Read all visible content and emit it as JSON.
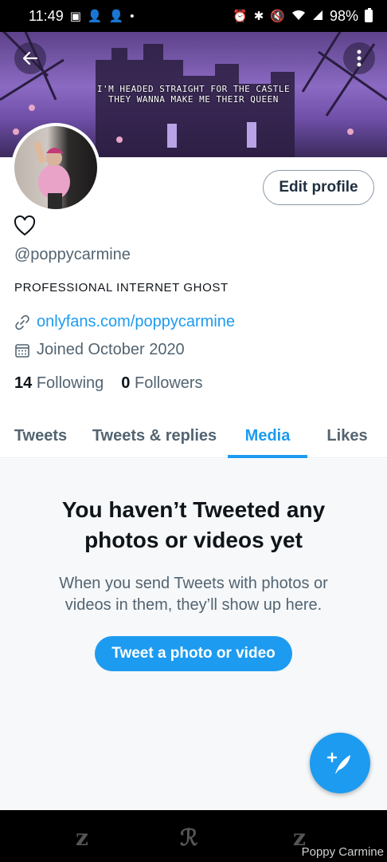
{
  "status_bar": {
    "time": "11:49",
    "battery": "98%",
    "left_icons": [
      "image-icon",
      "person-add-icon",
      "person-add-icon",
      "dot-icon"
    ],
    "right_icons": [
      "alarm-icon",
      "bluetooth-icon",
      "mute-icon",
      "wifi-icon",
      "signal-icon",
      "battery-icon"
    ]
  },
  "banner": {
    "line1": "I'M HEADED STRAIGHT FOR THE CASTLE",
    "line2": "THEY WANNA MAKE ME THEIR QUEEN"
  },
  "profile": {
    "edit_label": "Edit profile",
    "handle": "@poppycarmine",
    "bio": "PROFESSIONAL INTERNET GHOST",
    "link": "onlyfans.com/poppycarmine",
    "joined": "Joined October 2020",
    "following_count": "14",
    "following_label": "Following",
    "followers_count": "0",
    "followers_label": "Followers"
  },
  "tabs": [
    {
      "label": "Tweets"
    },
    {
      "label": "Tweets & replies"
    },
    {
      "label": "Media"
    },
    {
      "label": "Likes"
    }
  ],
  "empty_state": {
    "title": "You haven’t Tweeted any photos or videos yet",
    "subtitle": "When you send Tweets with photos or videos in them, they’ll show up here.",
    "button": "Tweet a photo or video"
  },
  "watermark": "Poppy Carmine",
  "colors": {
    "accent": "#1d9bf0",
    "secondary_text": "#536471",
    "empty_bg": "#f6f8fa"
  }
}
